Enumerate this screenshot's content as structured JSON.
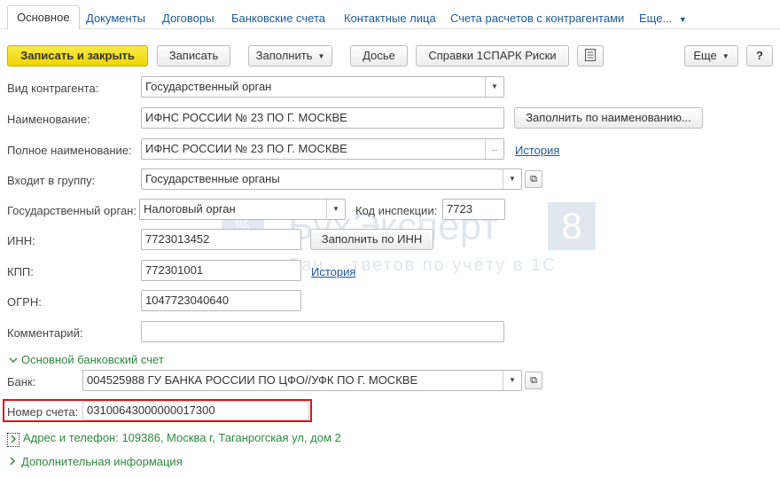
{
  "tabs": {
    "main": "Основное",
    "documents": "Документы",
    "contracts": "Договоры",
    "bank_accounts": "Банковские счета",
    "contacts": "Контактные лица",
    "settlements": "Счета расчетов с контрагентами",
    "more": "Еще..."
  },
  "toolbar": {
    "save_close": "Записать и закрыть",
    "save": "Записать",
    "fill": "Заполнить",
    "dossier": "Досье",
    "spark": "Справки 1СПАРК Риски",
    "more": "Еще",
    "help": "?"
  },
  "form": {
    "kind_label": "Вид контрагента:",
    "kind_value": "Государственный орган",
    "name_label": "Наименование:",
    "name_value": "ИФНС РОССИИ № 23 ПО Г. МОСКВЕ",
    "fill_by_name": "Заполнить по наименованию...",
    "full_name_label": "Полное наименование:",
    "full_name_value": "ИФНС РОССИИ № 23 ПО Г. МОСКВЕ",
    "full_name_ellipsis": "...",
    "history": "История",
    "group_label": "Входит в группу:",
    "group_value": "Государственные органы",
    "gov_label": "Государственный орган:",
    "gov_value": "Налоговый орган",
    "inspection_label": "Код инспекции:",
    "inspection_value": "7723",
    "inn_label": "ИНН:",
    "inn_value": "7723013452",
    "fill_by_inn": "Заполнить по ИНН",
    "kpp_label": "КПП:",
    "kpp_value": "772301001",
    "kpp_history": "История",
    "ogrn_label": "ОГРН:",
    "ogrn_value": "1047723040640",
    "comment_label": "Комментарий:",
    "comment_value": ""
  },
  "bank_section": {
    "title": "Основной банковский счет",
    "bank_label": "Банк:",
    "bank_value": "004525988 ГУ БАНКА РОССИИ ПО ЦФО//УФК ПО Г. МОСКВЕ",
    "account_label": "Номер счета:",
    "account_value": "03100643000000017300"
  },
  "address_section": {
    "title": "Адрес и телефон: 109386, Москва г, Таганрогская ул, дом 2"
  },
  "extra_section": {
    "title": "Дополнительная информация"
  },
  "watermark": {
    "brand": "БухЭксперт",
    "digit": "8",
    "tagline": "Бан    тветов по учёту в 1С"
  },
  "colors": {
    "primary_button": "#f0d400",
    "link": "#1c5a99",
    "group_title": "#2d8a3d",
    "highlight": "#d9141b"
  }
}
